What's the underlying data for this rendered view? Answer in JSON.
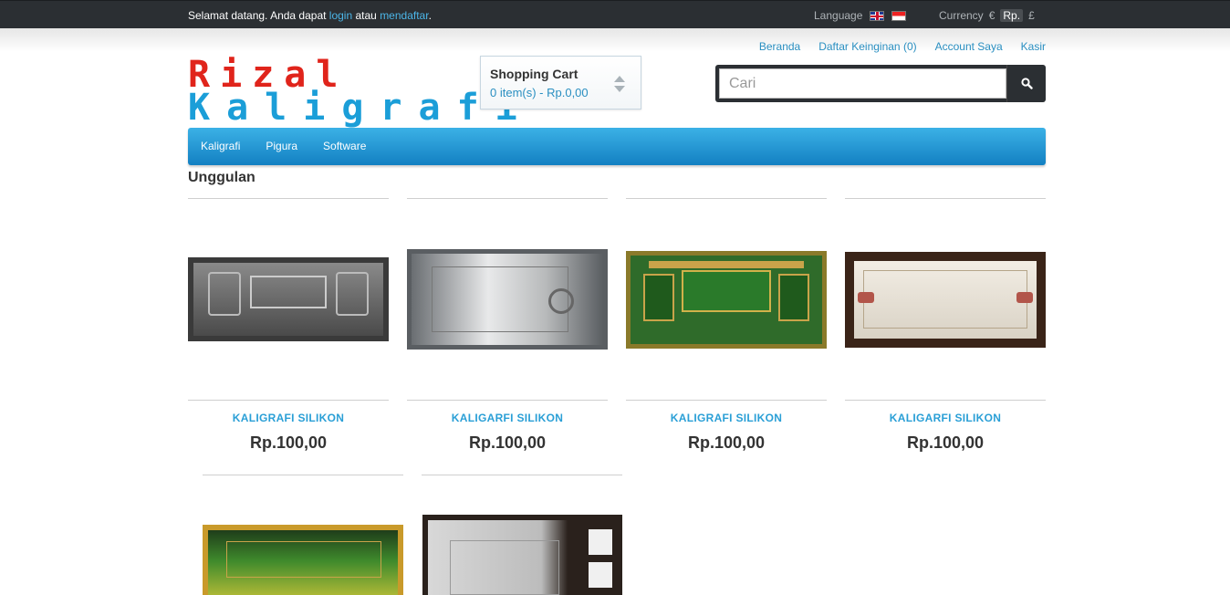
{
  "topbar": {
    "welcome_pre": "Selamat datang. Anda dapat ",
    "login": "login",
    "atau": " atau ",
    "register": "mendaftar",
    "period": ".",
    "language_label": "Language",
    "currency_label": "Currency",
    "currencies": [
      "€",
      "Rp.",
      "£"
    ]
  },
  "header_links": [
    "Beranda",
    "Daftar Keinginan (0)",
    "Account Saya",
    "Kasir"
  ],
  "logo": {
    "line1": "Rizal",
    "line2": "Kaligrafi"
  },
  "cart": {
    "title": "Shopping Cart",
    "summary": "0 item(s) - Rp.0,00"
  },
  "search": {
    "placeholder": "Cari"
  },
  "nav": [
    "Kaligrafi",
    "Pigura",
    "Software"
  ],
  "section_title": "Unggulan",
  "products": [
    {
      "name": "KALIGRAFI SILIKON",
      "price": "Rp.100,00",
      "frame": "#3a3a3a",
      "inner": "#6f6f6f"
    },
    {
      "name": "KALIGARFI SILIKON",
      "price": "Rp.100,00",
      "frame": "#5a5e62",
      "inner": "#c9cbcc"
    },
    {
      "name": "KALIGRAFI SILIKON",
      "price": "Rp.100,00",
      "frame": "#8a7a2a",
      "inner": "#2f6b2a"
    },
    {
      "name": "KALIGARFI SILIKON",
      "price": "Rp.100,00",
      "frame": "#3a2418",
      "inner": "#e3ddd2"
    },
    {
      "frame": "#c99a2a",
      "inner": "#3f8a2c"
    },
    {
      "frame": "#2a211c",
      "inner": "#cfcfcf"
    }
  ],
  "colors": {
    "accent": "#2a9fd6",
    "topbar": "#2b2f33",
    "nav": "#1b8fd0"
  }
}
